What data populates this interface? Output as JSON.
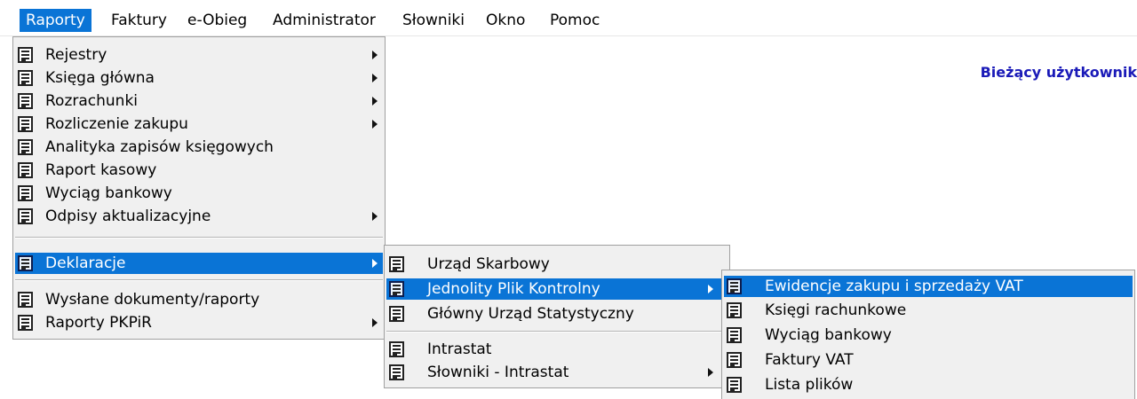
{
  "menubar": {
    "items": [
      "Raporty",
      "Faktury",
      "e-Obieg",
      "Administrator",
      "Słowniki",
      "Okno",
      "Pomoc"
    ]
  },
  "workspace": {
    "current_user_label": "Bieżący użytkownik"
  },
  "raporty_menu": {
    "items": [
      {
        "label": "Rejestry",
        "submenu": true
      },
      {
        "label": "Księga główna",
        "submenu": true
      },
      {
        "label": "Rozrachunki",
        "submenu": true
      },
      {
        "label": "Rozliczenie zakupu",
        "submenu": true
      },
      {
        "label": "Analityka zapisów księgowych",
        "submenu": false
      },
      {
        "label": "Raport kasowy",
        "submenu": false
      },
      {
        "label": "Wyciąg bankowy",
        "submenu": false
      },
      {
        "label": "Odpisy aktualizacyjne",
        "submenu": true
      },
      {
        "label": "Deklaracje",
        "submenu": true,
        "selected": true
      },
      {
        "label": "Wysłane dokumenty/raporty",
        "submenu": false
      },
      {
        "label": "Raporty PKPiR",
        "submenu": true
      }
    ]
  },
  "deklaracje_menu": {
    "items": [
      {
        "label": "Urząd Skarbowy",
        "submenu": false
      },
      {
        "label": "Jednolity Plik Kontrolny",
        "submenu": true,
        "selected": true
      },
      {
        "label": "Główny Urząd Statystyczny",
        "submenu": false
      },
      {
        "label": "Intrastat",
        "submenu": false
      },
      {
        "label": "Słowniki - Intrastat",
        "submenu": true
      }
    ]
  },
  "jpk_menu": {
    "items": [
      {
        "label": "Ewidencje zakupu i sprzedaży VAT",
        "selected": true
      },
      {
        "label": "Księgi rachunkowe"
      },
      {
        "label": "Wyciąg bankowy"
      },
      {
        "label": "Faktury VAT"
      },
      {
        "label": "Lista plików"
      }
    ]
  },
  "colors": {
    "highlight": "#0a74d6",
    "menu_background": "#f0f0f0",
    "user_label": "#1a1ab8"
  }
}
